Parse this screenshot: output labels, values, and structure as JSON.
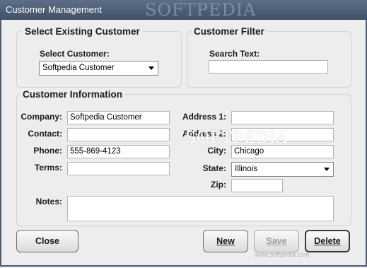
{
  "window": {
    "title": "Customer Management",
    "watermark": "SOFTPEDIA"
  },
  "select_group": {
    "title": "Select Existing Customer",
    "label": "Select Customer:",
    "selected": "Softpedia Customer"
  },
  "filter_group": {
    "title": "Customer Filter",
    "label": "Search Text:",
    "value": ""
  },
  "info_group": {
    "title": "Customer Information",
    "company": {
      "label": "Company:",
      "value": "Softpedia Customer"
    },
    "contact": {
      "label": "Contact:",
      "value": ""
    },
    "phone": {
      "label": "Phone:",
      "value": "555-869-4123"
    },
    "terms": {
      "label": "Terms:",
      "value": ""
    },
    "address1": {
      "label": "Address 1:",
      "value": ""
    },
    "address2": {
      "label": "Address 2:",
      "value": ""
    },
    "city": {
      "label": "City:",
      "value": "Chicago"
    },
    "state": {
      "label": "State:",
      "value": "Illinois"
    },
    "zip": {
      "label": "Zip:",
      "value": ""
    },
    "notes": {
      "label": "Notes:",
      "value": ""
    }
  },
  "buttons": {
    "close": "Close",
    "new": "New",
    "save": "Save",
    "delete": "Delete"
  },
  "watermark_text": "SOFTPEDIA",
  "watermark_small": "www.softpedia.com"
}
